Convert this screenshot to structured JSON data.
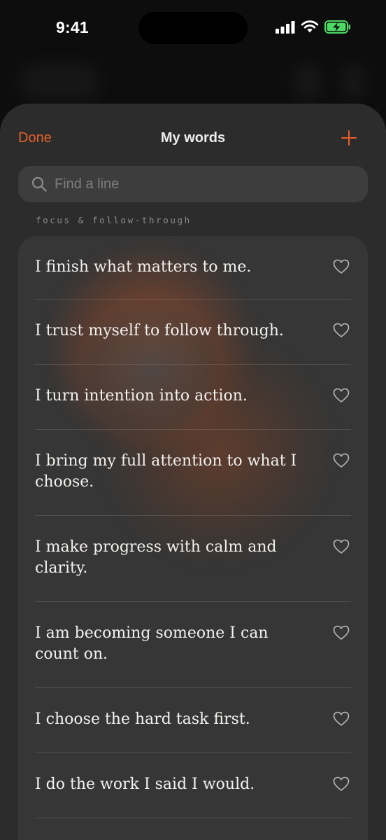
{
  "status_bar": {
    "time": "9:41"
  },
  "header": {
    "done_label": "Done",
    "title": "My words",
    "add_icon": "plus-icon"
  },
  "search": {
    "placeholder": "Find a line",
    "value": ""
  },
  "section": {
    "label": "focus & follow-through"
  },
  "colors": {
    "accent": "#e6602a",
    "battery": "#4cd964"
  },
  "items": [
    {
      "text": "I finish what matters to me.",
      "favorite": false
    },
    {
      "text": "I trust myself to follow through.",
      "favorite": false
    },
    {
      "text": "I turn intention into action.",
      "favorite": false
    },
    {
      "text": "I bring my full attention to what I choose.",
      "favorite": false
    },
    {
      "text": "I make progress with calm and clarity.",
      "favorite": false
    },
    {
      "text": "I am becoming someone I can count on.",
      "favorite": false
    },
    {
      "text": "I choose the hard task first.",
      "favorite": false
    },
    {
      "text": "I do the work I said I would.",
      "favorite": false
    }
  ]
}
